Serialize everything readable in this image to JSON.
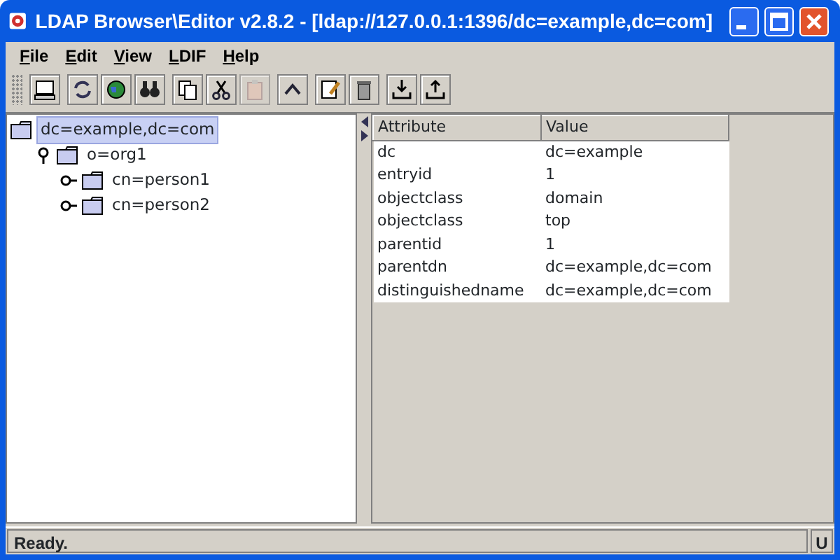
{
  "window": {
    "title": "LDAP Browser\\Editor v2.8.2 - [ldap://127.0.0.1:1396/dc=example,dc=com]"
  },
  "menu": [
    "File",
    "Edit",
    "View",
    "LDIF",
    "Help"
  ],
  "toolbar": [
    [
      {
        "kind": "connect",
        "disabled": false
      }
    ],
    [
      {
        "kind": "refresh",
        "disabled": false
      },
      {
        "kind": "globe",
        "disabled": false
      },
      {
        "kind": "search",
        "disabled": false
      }
    ],
    [
      {
        "kind": "copy",
        "disabled": false
      },
      {
        "kind": "cut",
        "disabled": false
      },
      {
        "kind": "paste",
        "disabled": true
      }
    ],
    [
      {
        "kind": "up",
        "disabled": false
      }
    ],
    [
      {
        "kind": "edit",
        "disabled": false
      },
      {
        "kind": "delete",
        "disabled": false
      }
    ],
    [
      {
        "kind": "import",
        "disabled": false
      },
      {
        "kind": "export",
        "disabled": false
      }
    ]
  ],
  "tree": [
    {
      "label": "dc=example,dc=com",
      "selected": true,
      "children": [
        {
          "label": "o=org1",
          "selected": false,
          "expanded": true,
          "children": [
            {
              "label": "cn=person1",
              "selected": false,
              "expanded": false
            },
            {
              "label": "cn=person2",
              "selected": false,
              "expanded": false
            }
          ]
        }
      ]
    }
  ],
  "table": {
    "columns": [
      "Attribute",
      "Value"
    ],
    "rows": [
      [
        "dc",
        "dc=example"
      ],
      [
        "entryid",
        "1"
      ],
      [
        "objectclass",
        "domain"
      ],
      [
        "objectclass",
        "top"
      ],
      [
        "parentid",
        "1"
      ],
      [
        "parentdn",
        "dc=example,dc=com"
      ],
      [
        "distinguishedname",
        "dc=example,dc=com"
      ]
    ]
  },
  "status_bar": {
    "message": "Ready.",
    "indicator": "U"
  }
}
